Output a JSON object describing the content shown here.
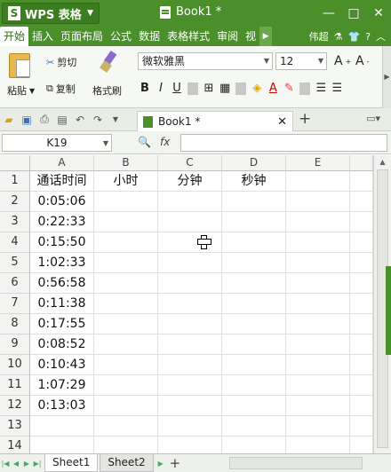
{
  "app": {
    "name": "WPS 表格",
    "doc_title": "Book1 *"
  },
  "window": {
    "minimize": "—",
    "maximize": "□",
    "close": "✕"
  },
  "menu": {
    "items": [
      "开始",
      "插入",
      "页面布局",
      "公式",
      "数据",
      "表格样式",
      "审阅",
      "视"
    ],
    "user": "伟超",
    "help": "?"
  },
  "ribbon": {
    "paste": "粘贴",
    "cut": "剪切",
    "copy": "复制",
    "format_painter": "格式刷",
    "font_name": "微软雅黑",
    "font_size": "12",
    "bold": "B",
    "italic": "I",
    "underline": "U"
  },
  "tab": {
    "doc_name": "Book1 *",
    "new": "+"
  },
  "formula": {
    "cell_ref": "K19",
    "fx": "fx",
    "content": ""
  },
  "grid": {
    "columns": [
      "A",
      "B",
      "C",
      "D",
      "E"
    ],
    "rows": [
      "1",
      "2",
      "3",
      "4",
      "5",
      "6",
      "7",
      "8",
      "9",
      "10",
      "11",
      "12",
      "13",
      "14"
    ],
    "header_row": [
      "通话时间",
      "小时",
      "分钟",
      "秒钟",
      ""
    ],
    "data": [
      "0:05:06",
      "0:22:33",
      "0:15:50",
      "1:02:33",
      "0:56:58",
      "0:11:38",
      "0:17:55",
      "0:08:52",
      "0:10:43",
      "1:07:29",
      "0:13:03"
    ]
  },
  "sheets": [
    "Sheet1",
    "Sheet2"
  ],
  "colors": {
    "brand": "#4a8f2a",
    "accent_dark": "#3d7d21"
  }
}
